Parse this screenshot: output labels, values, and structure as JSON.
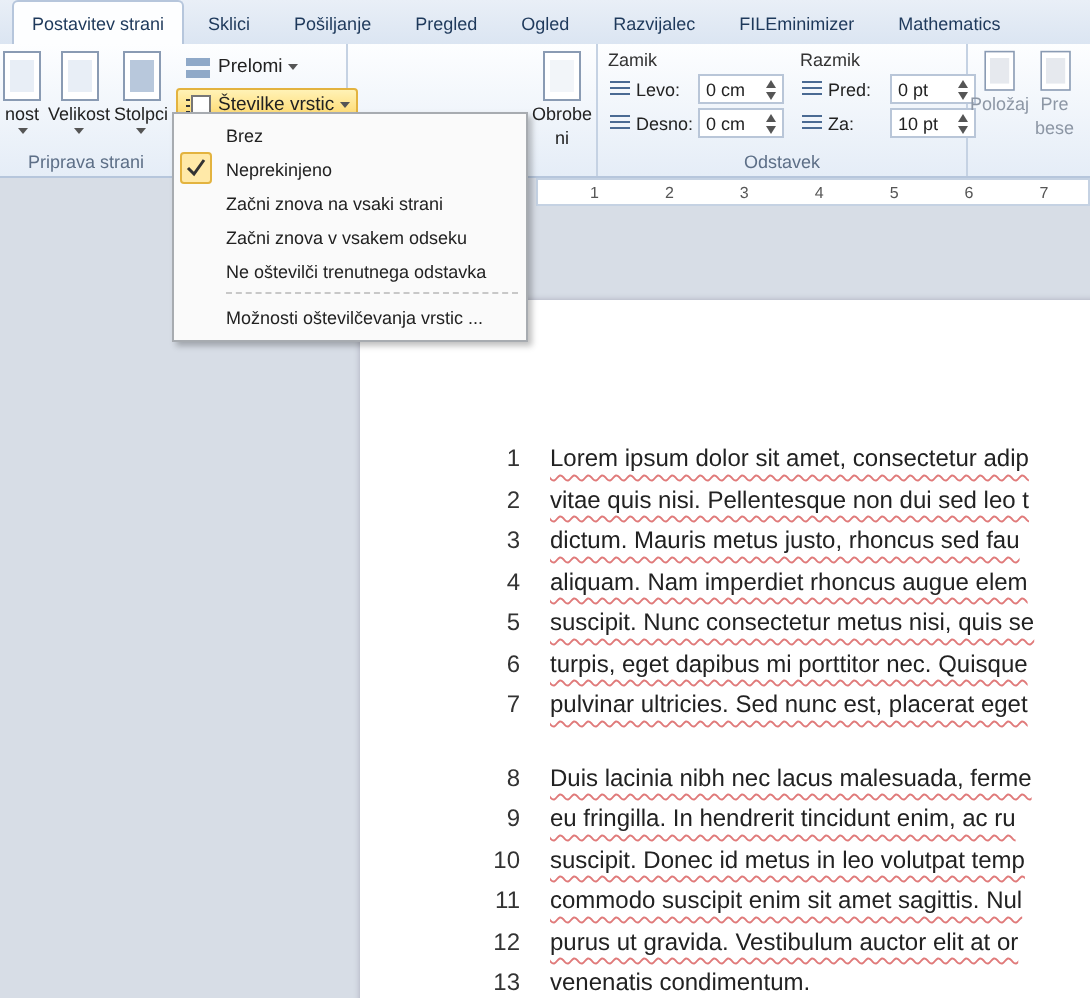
{
  "tabs": [
    {
      "label": "Postavitev strani",
      "selected": true
    },
    {
      "label": "Sklici",
      "selected": false
    },
    {
      "label": "Pošiljanje",
      "selected": false
    },
    {
      "label": "Pregled",
      "selected": false
    },
    {
      "label": "Ogled",
      "selected": false
    },
    {
      "label": "Razvijalec",
      "selected": false
    },
    {
      "label": "FILEminimizer",
      "selected": false
    },
    {
      "label": "Mathematics",
      "selected": false
    }
  ],
  "page_setup": {
    "buttons": [
      {
        "label": "nost"
      },
      {
        "label": "Velikost"
      },
      {
        "label": "Stolpci"
      }
    ],
    "breaks": "Prelomi",
    "line_numbers": {
      "label": "Številke vrstic",
      "active": true
    },
    "group_label": "Priprava strani"
  },
  "page_background": {
    "partial_label": [
      "Obrobe",
      "ni"
    ]
  },
  "paragraph": {
    "group_label": "Odstavek",
    "sections": [
      {
        "title": "Zamik",
        "fields": [
          {
            "label": "Levo:",
            "value": "0 cm"
          },
          {
            "label": "Desno:",
            "value": "0 cm"
          }
        ]
      },
      {
        "title": "Razmik",
        "fields": [
          {
            "label": "Pred:",
            "value": "0 pt"
          },
          {
            "label": "Za:",
            "value": "10 pt"
          }
        ]
      }
    ]
  },
  "arrange": {
    "buttons": [
      {
        "lines": [
          "Položaj"
        ],
        "disabled": true
      },
      {
        "lines": [
          "Pre",
          "bese"
        ],
        "disabled": true
      }
    ]
  },
  "menu": {
    "items": [
      {
        "label": "Brez",
        "checked": false
      },
      {
        "label": "Neprekinjeno",
        "checked": true
      },
      {
        "label": "Začni znova na vsaki strani",
        "checked": false
      },
      {
        "label": "Začni znova v vsakem odseku",
        "checked": false
      },
      {
        "label": "Ne oštevilči trenutnega odstavka",
        "checked": false
      }
    ],
    "footer_item": "Možnosti oštevilčevanja vrstic ..."
  },
  "ruler": {
    "ticks": [
      "1",
      "2",
      "3",
      "4",
      "5",
      "6",
      "7"
    ]
  },
  "document": {
    "paragraphs": [
      {
        "lines": [
          {
            "number": "1",
            "text": "Lorem ipsum dolor sit amet, consectetur adip"
          },
          {
            "number": "2",
            "text": "vitae quis nisi. Pellentesque  non dui sed leo t"
          },
          {
            "number": "3",
            "text": "dictum. Mauris metus justo, rhoncus sed fau"
          },
          {
            "number": "4",
            "text": "aliquam. Nam imperdiet rhoncus augue elem"
          },
          {
            "number": "5",
            "text": "suscipit. Nunc consectetur  metus nisi, quis se"
          },
          {
            "number": "6",
            "text": "turpis, eget dapibus mi porttitor nec. Quisque"
          },
          {
            "number": "7",
            "text": "pulvinar ultricies. Sed nunc est, placerat eget"
          }
        ]
      },
      {
        "lines": [
          {
            "number": "8",
            "text": "Duis lacinia nibh nec lacus malesuada, ferme"
          },
          {
            "number": "9",
            "text": "eu fringilla. In hendrerit tincidunt enim, ac ru"
          },
          {
            "number": "10",
            "text": "suscipit. Donec id metus in leo volutpat temp"
          },
          {
            "number": "11",
            "text": "commodo suscipit enim sit amet sagittis. Nul"
          },
          {
            "number": "12",
            "text": "purus ut gravida. Vestibulum auctor elit at or"
          },
          {
            "number": "13",
            "text": "venenatis condimentum."
          }
        ]
      }
    ]
  }
}
